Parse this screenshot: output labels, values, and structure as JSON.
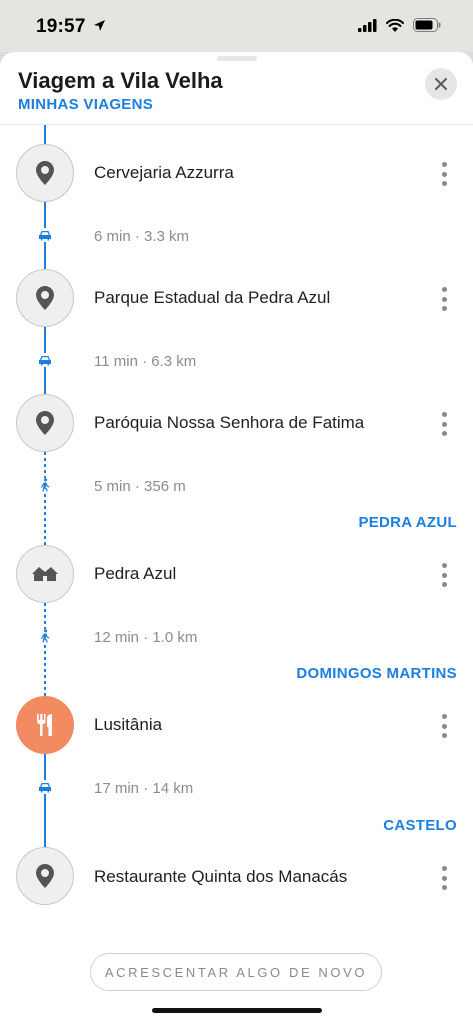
{
  "status": {
    "time": "19:57",
    "icons": [
      "location-arrow-icon",
      "cellular-signal-icon",
      "wifi-icon",
      "battery-icon"
    ]
  },
  "header": {
    "title": "Viagem a Vila Velha",
    "subtitle": "MINHAS VIAGENS",
    "close_icon": "close-icon"
  },
  "stops": [
    {
      "name": "Cervejaria Azzurra",
      "icon": "pin-icon"
    },
    {
      "name": "Parque Estadual da Pedra Azul",
      "icon": "pin-icon"
    },
    {
      "name": "Paróquia Nossa Senhora de Fatima",
      "icon": "pin-icon"
    },
    {
      "name": "Pedra Azul",
      "icon": "lodging-icon"
    },
    {
      "name": "Lusitânia",
      "icon": "restaurant-icon"
    },
    {
      "name": "Restaurante Quinta dos Manacás",
      "icon": "pin-icon"
    }
  ],
  "segments": [
    {
      "mode": "car",
      "info": "6 min · 3.3 km"
    },
    {
      "mode": "car",
      "info": "11 min · 6.3 km"
    },
    {
      "mode": "walk",
      "info": "5 min · 356 m"
    },
    {
      "mode": "walk",
      "info": "12 min · 1.0 km"
    },
    {
      "mode": "car",
      "info": "17 min · 14 km"
    }
  ],
  "regions": [
    "PEDRA AZUL",
    "DOMINGOS MARTINS",
    "CASTELO"
  ],
  "footer": {
    "add_label": "ACRESCENTAR ALGO DE NOVO"
  },
  "colors": {
    "accent": "#1a7fe0",
    "restaurant": "#f28b61",
    "icon_gray": "#555555"
  }
}
